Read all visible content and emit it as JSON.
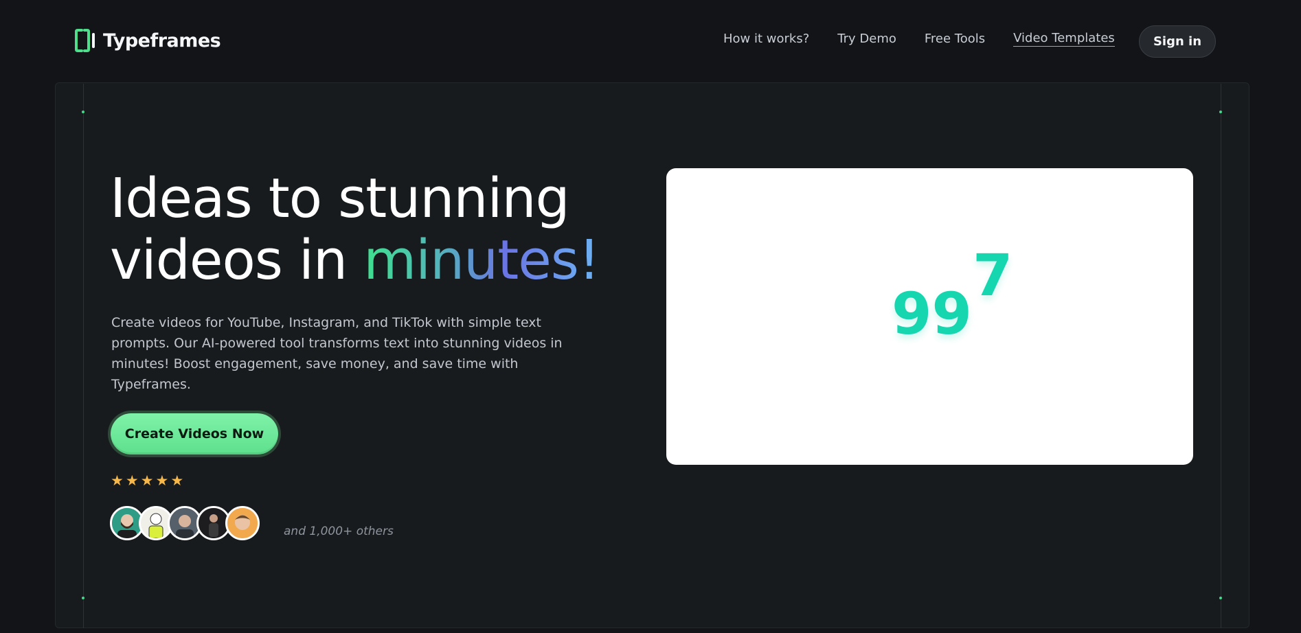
{
  "header": {
    "brand": "Typeframes",
    "nav": [
      {
        "label": "How it works?"
      },
      {
        "label": "Try Demo"
      },
      {
        "label": "Free Tools"
      },
      {
        "label": "Video Templates"
      }
    ],
    "signin_label": "Sign in"
  },
  "hero": {
    "headline_line1": "Ideas to stunning",
    "headline_line2_prefix": "videos in ",
    "headline_line2_highlight": "minutes!",
    "description": "Create videos for YouTube, Instagram, and TikTok with simple text prompts. Our AI-powered tool transforms text into stunning videos in minutes! Boost engagement, save money, and save time with Typeframes.",
    "cta_label": "Create Videos Now",
    "rating": {
      "stars": 5,
      "max": 5
    },
    "social_proof": "and 1,000+ others"
  },
  "preview": {
    "counter_base": "99",
    "counter_super": "7",
    "accent_color": "#16d6b0"
  },
  "colors": {
    "background": "#121417",
    "panel": "#181b1d",
    "cta": "#6ae899",
    "star": "#f7b84b"
  },
  "icons": {
    "logo": "typeframes-logo-icon",
    "star": "star-icon"
  }
}
